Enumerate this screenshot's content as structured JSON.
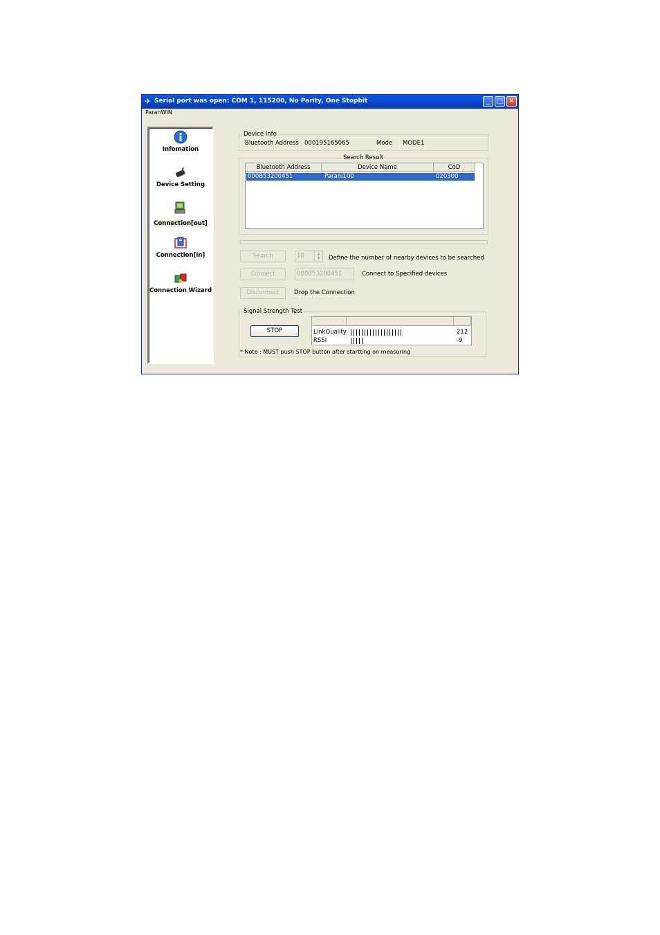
{
  "window": {
    "title": "Serial port was open: COM 1, 115200, No Parity, One Stopbit",
    "menu": "ParanWIN",
    "controls": {
      "minimize": "_",
      "maximize": "□",
      "close": "✕"
    }
  },
  "sidebar": {
    "items": [
      {
        "label": "Infomation",
        "icon": "info-icon"
      },
      {
        "label": "Device Setting",
        "icon": "device-setting-icon"
      },
      {
        "label": "Connection[out]",
        "icon": "connection-out-icon",
        "selected": true
      },
      {
        "label": "Connection[in]",
        "icon": "connection-in-icon"
      },
      {
        "label": "Connection Wizard",
        "icon": "connection-wizard-icon"
      }
    ]
  },
  "device_info": {
    "legend": "Device Info",
    "address_label": "Bluetooth Address",
    "address_value": "000195165065",
    "mode_label": "Mode",
    "mode_value": "MODE1"
  },
  "search_result": {
    "legend": "Search Result",
    "columns": [
      "Bluetooth Address",
      "Device Name",
      "CoD"
    ],
    "rows": [
      {
        "address": "000B53200451",
        "name": "Parani100",
        "cod": "020300",
        "selected": true
      }
    ]
  },
  "actions": {
    "search_button": "Search",
    "search_count": "10",
    "search_desc": "Define the number of nearby devices to be searched",
    "connect_button": "Connect",
    "connect_address": "000B53200451",
    "connect_desc": "Connect to Specified devices",
    "disconnect_button": "Disconnect",
    "disconnect_desc": "Drop the Connection"
  },
  "signal_test": {
    "legend": "Signal Strength Test",
    "stop_button": "STOP",
    "rows": [
      {
        "label": "LinkQuality",
        "value": "212",
        "bar_count": 19
      },
      {
        "label": "RSSI",
        "value": "-9",
        "bar_count": 5
      }
    ],
    "note": "* Note : MUST push STOP button after startting on measuring"
  },
  "colors": {
    "titlebar": "#0a5ae8",
    "selection": "#316ac5",
    "window_bg": "#ece9d8"
  }
}
